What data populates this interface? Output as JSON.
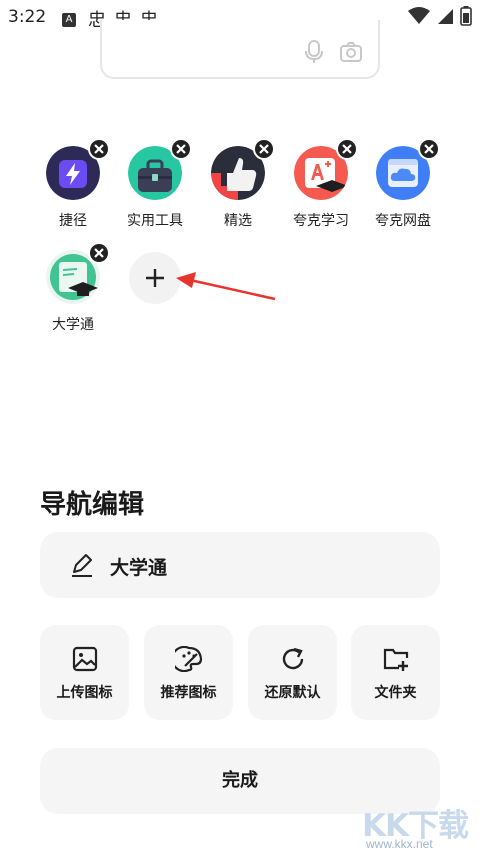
{
  "status_bar": {
    "time": "3:22",
    "notification_glyphs": [
      "忠",
      "忠",
      "忠"
    ]
  },
  "apps": [
    {
      "label": "捷径",
      "icon": "shortcut-icon"
    },
    {
      "label": "实用工具",
      "icon": "toolbox-icon"
    },
    {
      "label": "精选",
      "icon": "thumbs-up-icon"
    },
    {
      "label": "夸克学习",
      "icon": "study-icon"
    },
    {
      "label": "夸克网盘",
      "icon": "cloud-drive-icon"
    },
    {
      "label": "大学通",
      "icon": "graduation-icon"
    }
  ],
  "add_button": {
    "icon": "plus-icon"
  },
  "panel": {
    "title": "导航编辑",
    "name_value": "大学通",
    "actions": [
      {
        "label": "上传图标",
        "icon": "image-icon"
      },
      {
        "label": "推荐图标",
        "icon": "palette-icon"
      },
      {
        "label": "还原默认",
        "icon": "refresh-icon"
      },
      {
        "label": "文件夹",
        "icon": "folder-add-icon"
      }
    ],
    "done_label": "完成"
  },
  "watermark": {
    "logo": "KK下载",
    "url": "www.kkx.net"
  },
  "colors": {
    "annotation_arrow": "#e8342e",
    "panel_bg": "#f5f5f5"
  }
}
